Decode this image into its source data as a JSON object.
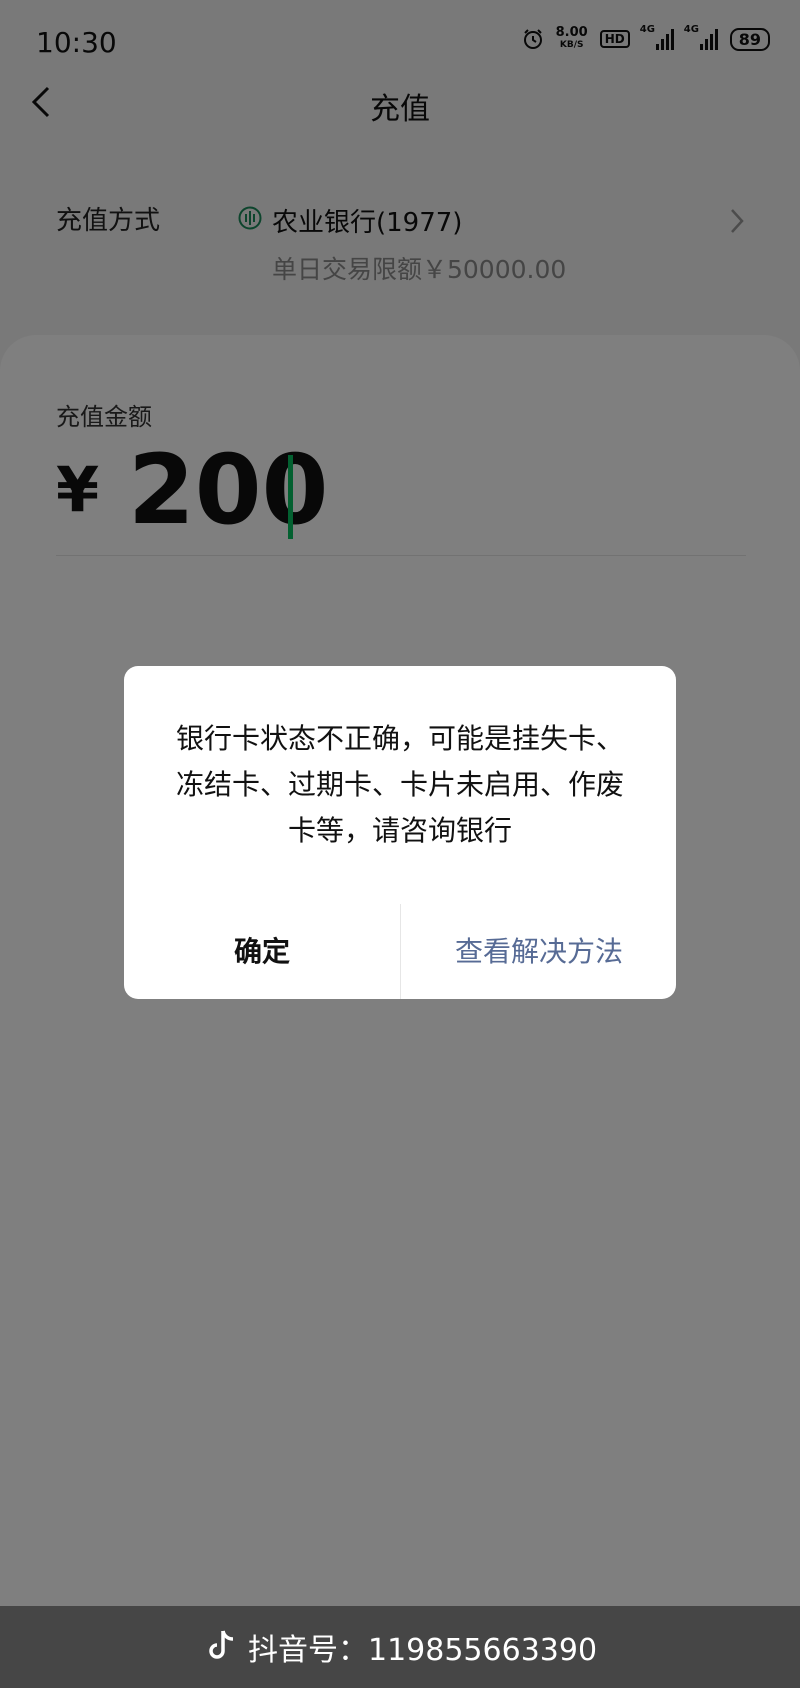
{
  "status_bar": {
    "time": "10:30",
    "net_speed_value": "8.00",
    "net_speed_unit": "KB/S",
    "hd_label": "HD",
    "signal1_label": "4G",
    "signal2_label": "4G",
    "battery": "89"
  },
  "nav": {
    "title": "充值"
  },
  "payment_method": {
    "label": "充值方式",
    "bank_name": "农业银行(1977)",
    "limit": "单日交易限额￥50000.00"
  },
  "amount": {
    "label": "充值金额",
    "currency": "¥",
    "value": "200"
  },
  "dialog": {
    "message": "银行卡状态不正确，可能是挂失卡、冻结卡、过期卡、卡片未启用、作废卡等，请咨询银行",
    "confirm_label": "确定",
    "solution_label": "查看解决方法"
  },
  "watermark": {
    "text": "抖音号：11985566339​0"
  },
  "colors": {
    "accent": "#07c160",
    "link": "#576b95",
    "bank_icon": "#1b8a5a"
  }
}
